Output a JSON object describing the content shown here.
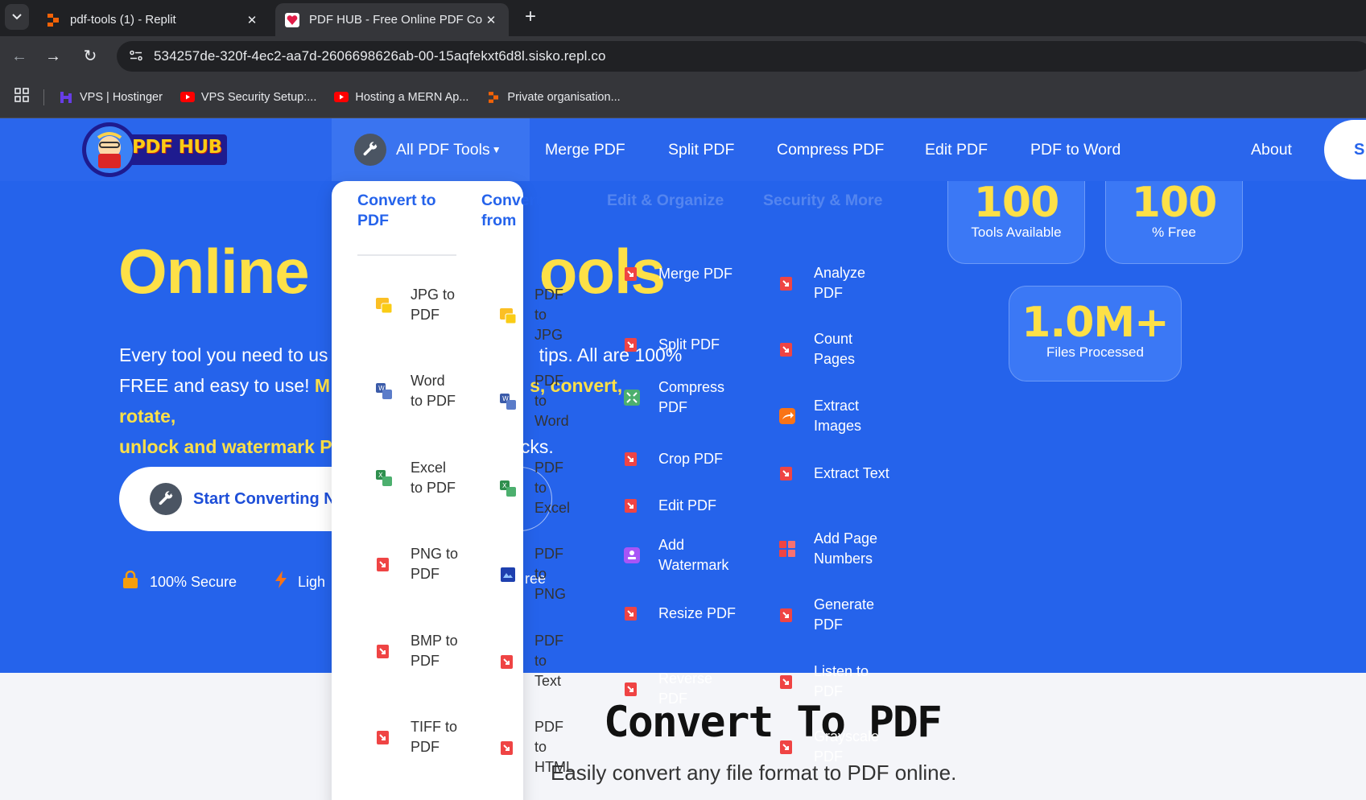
{
  "browser": {
    "tabs": [
      {
        "title": "pdf-tools (1) - Replit",
        "active": false
      },
      {
        "title": "PDF HUB - Free Online PDF Co",
        "active": true
      }
    ],
    "url": "534257de-320f-4ec2-aa7d-2606698626ab-00-15aqfekxt6d8l.sisko.repl.co",
    "bookmarks": [
      "VPS | Hostinger",
      "VPS Security Setup:...",
      "Hosting a MERN Ap...",
      "Private organisation..."
    ]
  },
  "nav": {
    "logo_text": "PDF HUB",
    "all_tools": "All PDF Tools",
    "items": [
      "Merge PDF",
      "Split PDF",
      "Compress PDF",
      "Edit PDF",
      "PDF to Word",
      "About"
    ],
    "cta": "S"
  },
  "hero": {
    "title_left": "Online",
    "title_right": "ools",
    "sub_line1_a": "Every tool you need to us",
    "sub_line1_b": "tips. All are 100%",
    "sub_line2_a": "FREE and easy to use! ",
    "sub_line2_hl_a": "M",
    "sub_line2_hl_b": "s, convert, rotate,",
    "sub_line3_hl": "unlock and watermark ",
    "sub_line3_hl_cut": "P",
    "sub_line3_b": "licks.",
    "cta_label": "Start Converting N",
    "features": [
      "100% Secure",
      "Ligh",
      "ree"
    ]
  },
  "stats": [
    {
      "value": "100",
      "label": "Tools Available"
    },
    {
      "value": "100",
      "label": "% Free"
    },
    {
      "value": "1.0M+",
      "label": "Files Processed"
    }
  ],
  "dropdown": {
    "headers": [
      "Convert to PDF",
      "Convert from PDF",
      "Edit & Organize",
      "Security & More"
    ],
    "convert_to": [
      "JPG to PDF",
      "Word to PDF",
      "Excel to PDF",
      "PNG to PDF",
      "BMP to PDF",
      "TIFF to PDF"
    ],
    "convert_from": [
      "PDF to JPG",
      "PDF to Word",
      "PDF to Excel",
      "PDF to PNG",
      "PDF to Text",
      "PDF to HTML"
    ],
    "edit_organize": [
      "Merge PDF",
      "Split PDF",
      "Compress PDF",
      "Crop PDF",
      "Edit PDF",
      "Add Watermark",
      "Resize PDF",
      "Reverse PDF"
    ],
    "security_more": [
      "Analyze PDF",
      "Count Pages",
      "Extract Images",
      "Extract Text",
      "Add Page Numbers",
      "Generate PDF",
      "Listen to PDF",
      "Grayscale PDF"
    ]
  },
  "section": {
    "title": "Convert To PDF",
    "subtitle": "Easily convert any file format to PDF online."
  }
}
